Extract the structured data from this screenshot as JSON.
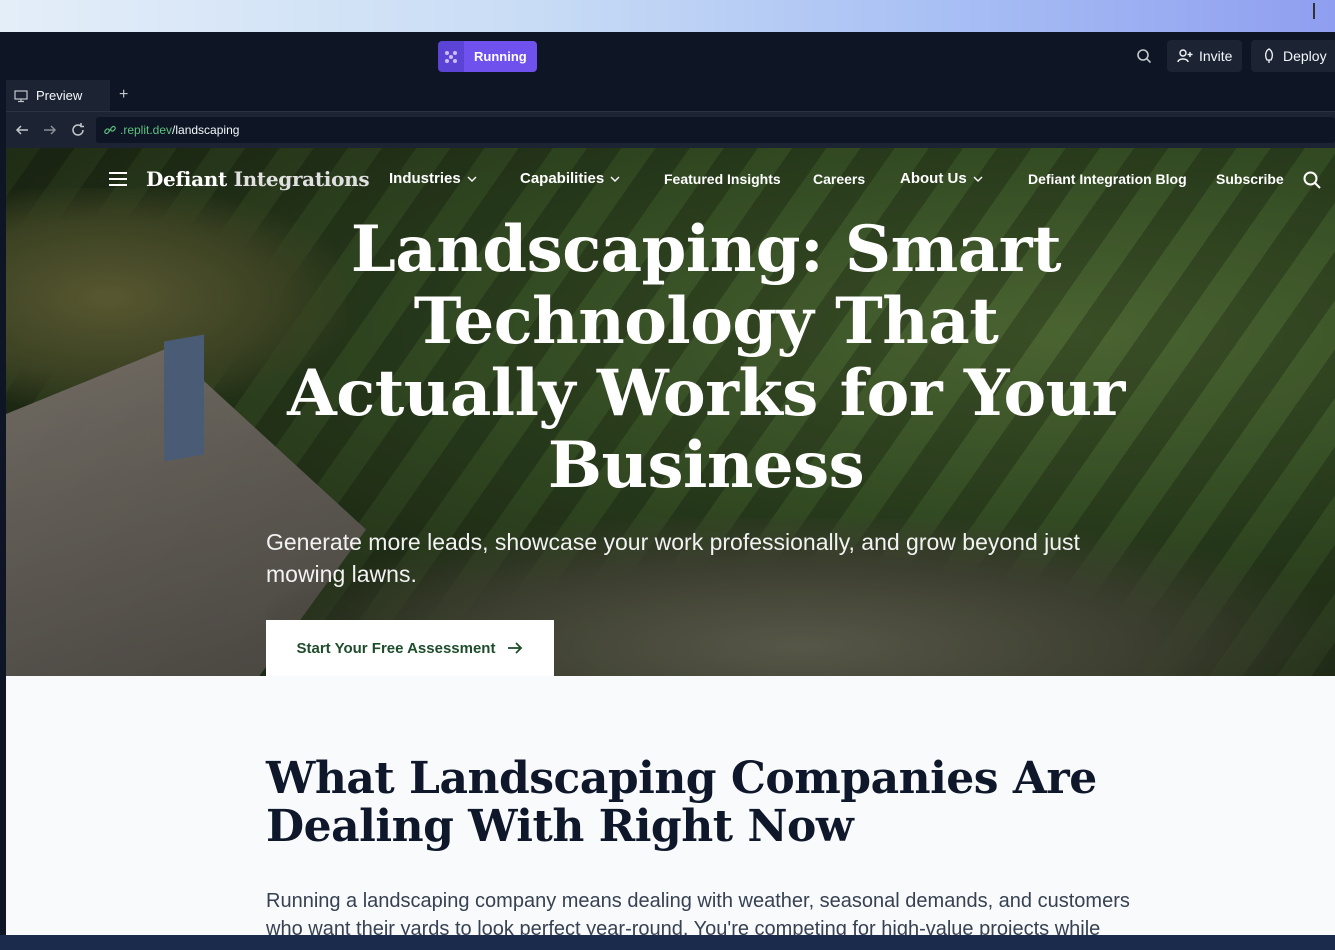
{
  "topbar": {
    "run_label": "Running",
    "invite_label": "Invite",
    "deploy_label": "Deploy"
  },
  "tabs": {
    "preview_label": "Preview",
    "add_label": "+"
  },
  "address": {
    "domain": ".replit.dev",
    "path": "/landscaping"
  },
  "site": {
    "brand_part1": "Defiant",
    "brand_part2": "Integrations",
    "nav": {
      "industries": "Industries",
      "capabilities": "Capabilities",
      "featured": "Featured Insights",
      "careers": "Careers",
      "about": "About Us",
      "blog": "Defiant Integration Blog",
      "subscribe": "Subscribe"
    },
    "hero_title": "Landscaping: Smart Technology That Actually Works for Your Business",
    "hero_subtitle": "Generate more leads, showcase your work professionally, and grow beyond just mowing lawns.",
    "cta_label": "Start Your Free Assessment",
    "section_heading": "What Landscaping Companies Are Dealing With Right Now",
    "section_text": "Running a landscaping company means dealing with weather, seasonal demands, and customers who want their yards to look perfect year-round. You're competing for high-value projects while managing"
  }
}
